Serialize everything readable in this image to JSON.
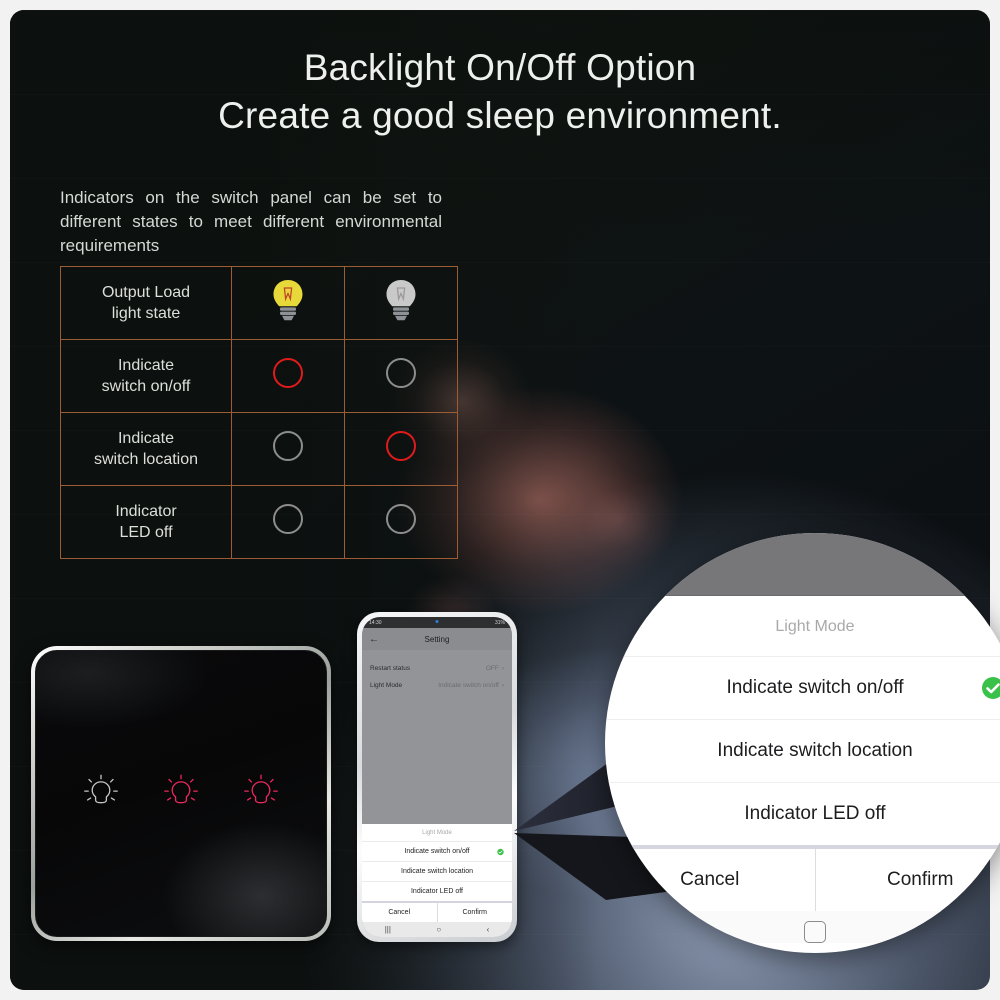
{
  "heading": {
    "line1": "Backlight On/Off Option",
    "line2": "Create a good sleep environment."
  },
  "intro": "Indicators on the switch panel can be set to different states to meet different environmental requirements",
  "table": {
    "rows": [
      {
        "label": "Output Load\nlight state",
        "left": "bulb-on",
        "right": "bulb-off"
      },
      {
        "label": "Indicate\nswitch on/off",
        "left": "led-red",
        "right": "led-gray"
      },
      {
        "label": "Indicate\nswitch location",
        "left": "led-gray",
        "right": "led-red"
      },
      {
        "label": "Indicator\nLED off",
        "left": "led-gray",
        "right": "led-gray"
      }
    ],
    "labels": {
      "r0": "Output Load light state",
      "r1": "Indicate switch on/off",
      "r2": "Indicate switch location",
      "r3": "Indicator LED off"
    },
    "border_color": "#9c5c34"
  },
  "switch_panel": {
    "indicators": [
      "off",
      "on",
      "on"
    ],
    "on_color": "#f0275c",
    "off_color": "#bdbdbd"
  },
  "phone": {
    "status": {
      "time": "14:30",
      "battery": "31%"
    },
    "appbar": {
      "back": "←",
      "title": "Setting"
    },
    "rows": [
      {
        "label": "Restart status",
        "value": "OFF",
        "chevron": "›"
      },
      {
        "label": "Light Mode",
        "value": "Indicate switch on/off",
        "chevron": "›"
      }
    ],
    "sheet": {
      "title": "Light Mode",
      "options": [
        "Indicate switch on/off",
        "Indicate switch location",
        "Indicator LED off"
      ],
      "selected_index": 0,
      "cancel": "Cancel",
      "confirm": "Confirm"
    },
    "navbar": {
      "recent": "|||",
      "home": "○",
      "back": "‹"
    }
  },
  "callout": {
    "title": "Light Mode",
    "options": [
      "Indicate switch on/off",
      "Indicate switch location",
      "Indicator LED off"
    ],
    "selected_index": 0,
    "cancel": "Cancel",
    "confirm": "Confirm",
    "check_color": "#3ac14a"
  }
}
